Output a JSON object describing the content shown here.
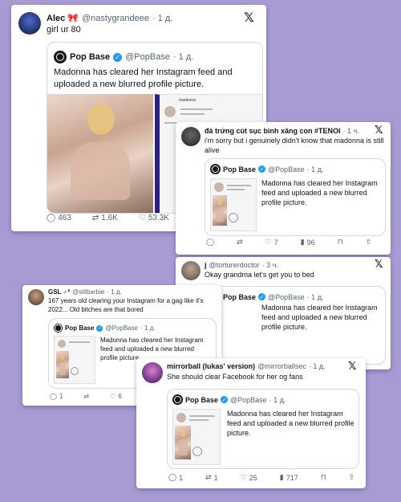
{
  "x_logo": "𝕏",
  "colors": {
    "background": "#a89bd3",
    "verified": "#1d9bf0"
  },
  "quoted_post": {
    "name": "Pop Base",
    "handle": "@PopBase",
    "time": "· 1 д.",
    "text": "Madonna has cleared her Instagram feed and uploaded a new blurred profile picture."
  },
  "insta_username": "madonna",
  "tweets": [
    {
      "name": "Alec 🎀",
      "handle": "@nastygrandeee",
      "time": "· 1 д.",
      "text": "girl ur 80",
      "actions": {
        "reply": "463",
        "repost": "1.6K",
        "like": "53.3K"
      }
    },
    {
      "name": "đá trứng cút sục bình xăng con #TENOI",
      "handle": "· 1 ч.",
      "time": "",
      "text": "i'm sorry but i genuinely didn't know that madonna is still alive",
      "actions": {
        "reply": "",
        "repost": "",
        "like": "7",
        "views": "96"
      }
    },
    {
      "name": "j",
      "handle": "@torturerdoctor",
      "time": "· 3 ч.",
      "text": "Okay grandma let's get you to bed"
    },
    {
      "name": "GSL ♂²",
      "handle": "@slitbarbie",
      "time": "· 1 д.",
      "text": "167 years old clearing your Instagram for a gag like it's 2022... Old bitches are that bored",
      "actions": {
        "reply": "1",
        "repost": "",
        "like": "6"
      }
    },
    {
      "name": "mirrorball (lukas' version)",
      "handle": "@mirrorballsec",
      "time": "· 1 д.",
      "text": "She should clear Facebook for her og fans",
      "actions": {
        "reply": "1",
        "repost": "1",
        "like": "25",
        "views": "717"
      }
    }
  ]
}
